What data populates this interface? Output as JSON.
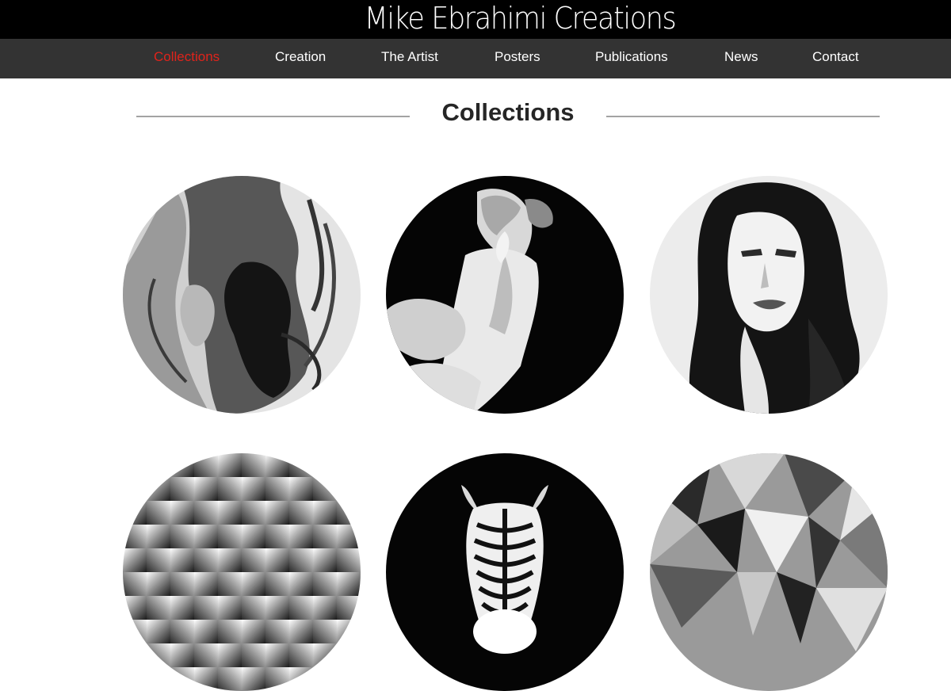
{
  "site": {
    "title": "Mike Ebrahimi Creations"
  },
  "nav": {
    "items": [
      {
        "label": "Collections",
        "active": true
      },
      {
        "label": "Creation",
        "active": false
      },
      {
        "label": "The Artist",
        "active": false
      },
      {
        "label": "Posters",
        "active": false
      },
      {
        "label": "Publications",
        "active": false
      },
      {
        "label": "News",
        "active": false
      },
      {
        "label": "Contact",
        "active": false
      }
    ]
  },
  "main": {
    "heading": "Collections"
  },
  "colors": {
    "header_bg": "#000000",
    "nav_bg": "#333333",
    "nav_active": "#e0231b",
    "nav_text": "#ffffff",
    "heading_text": "#262626",
    "rule": "#a3a3a3"
  }
}
